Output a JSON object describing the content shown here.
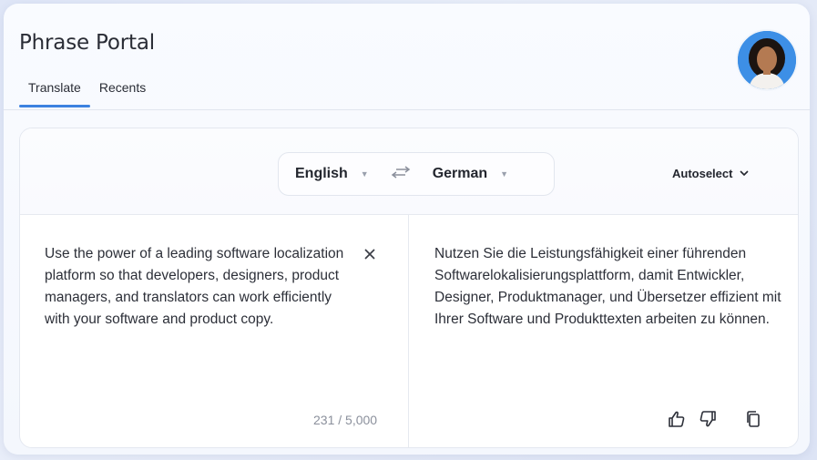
{
  "app": {
    "title": "Phrase Portal"
  },
  "tabs": [
    {
      "label": "Translate",
      "active": true
    },
    {
      "label": "Recents",
      "active": false
    }
  ],
  "translator": {
    "source_language": "English",
    "target_language": "German",
    "autoselect_label": "Autoselect",
    "source_text": "Use the power of a leading software localization platform so that developers, designers, product managers, and translators can work efficiently with your software and product copy.",
    "target_text": "Nutzen Sie die Leistungsfähigkeit einer führenden Softwarelokalisierungsplattform, damit Entwickler, Designer, Produktmanager, und Übersetzer effizient mit Ihrer Software und Produkttexten arbeiten zu können.",
    "char_count": "231 / 5,000"
  },
  "icons": {
    "clear": "close-icon",
    "swap": "swap-arrows-icon",
    "thumbs_up": "thumbs-up-icon",
    "thumbs_down": "thumbs-down-icon",
    "copy": "copy-icon"
  },
  "colors": {
    "accent": "#3c82e0",
    "avatar_bg": "#3d8fe6"
  }
}
